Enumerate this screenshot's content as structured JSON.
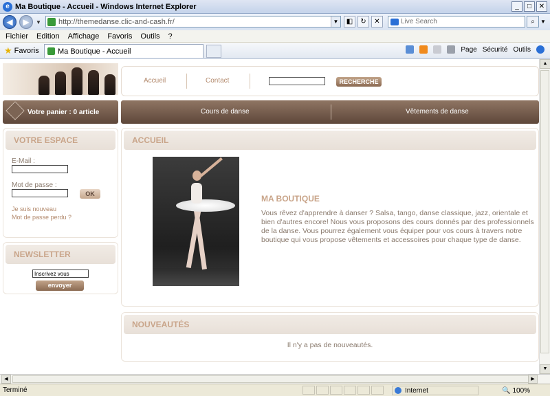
{
  "window": {
    "title": "Ma Boutique - Accueil - Windows Internet Explorer"
  },
  "address": {
    "url": "http://themedanse.clic-and-cash.fr/",
    "search_placeholder": "Live Search"
  },
  "menu": [
    "Fichier",
    "Edition",
    "Affichage",
    "Favoris",
    "Outils",
    "?"
  ],
  "favorites": {
    "label": "Favoris",
    "tab_title": "Ma Boutique - Accueil"
  },
  "commandbar": {
    "page": "Page",
    "security": "Sécurité",
    "tools": "Outils"
  },
  "site": {
    "nav": {
      "home": "Accueil",
      "contact": "Contact",
      "search_button": "RECHERCHE"
    },
    "cart": "Votre panier : 0 article",
    "categories": [
      "Cours de danse",
      "Vêtements de danse"
    ],
    "account": {
      "heading": "VOTRE ESPACE",
      "email_label": "E-Mail :",
      "password_label": "Mot de passe :",
      "ok": "OK",
      "new_user": "Je suis nouveau",
      "lost_password": "Mot de passe perdu ?"
    },
    "newsletter": {
      "heading": "NEWSLETTER",
      "placeholder": "Inscrivez vous",
      "send": "envoyer"
    },
    "home": {
      "heading": "ACCUEIL",
      "title": "MA BOUTIQUE",
      "text": "Vous rêvez d'apprendre à danser ? Salsa, tango, danse classique, jazz, orientale et bien d'autres encore! Nous vous proposons des cours donnés par des professionnels de la danse. Vous pourrez également vous équiper pour vos cours à travers notre boutique qui vous propose vêtements et accessoires pour chaque type de danse."
    },
    "news": {
      "heading": "NOUVEAUTÉS",
      "empty": "Il n'y a pas de nouveautés."
    }
  },
  "status": {
    "text": "Terminé",
    "zone": "Internet",
    "zoom": "100%"
  },
  "colors": {
    "accent": "#c9a58a",
    "nav_brown": "#6f5546",
    "text": "#8a7a6d"
  }
}
